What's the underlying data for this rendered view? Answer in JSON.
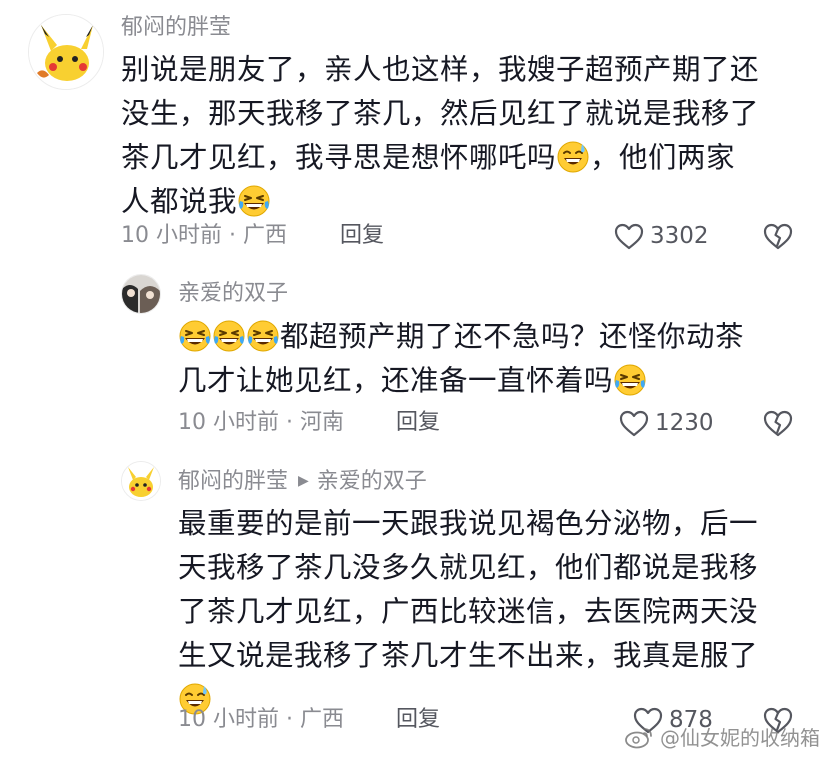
{
  "comments": [
    {
      "username": "郁闷的胖莹",
      "lines": [
        "别说是朋友了，亲人也这样，我嫂子超预产期了还",
        "没生，那天我移了茶几，然后见红了就说是我移了",
        "茶几才见红，我寻思是想怀哪吒吗",
        "人都说我"
      ],
      "line3_tail": "，他们两家",
      "meta": "10 小时前 · 广西",
      "reply": "回复",
      "likes": "3302"
    },
    {
      "username": "亲爱的双子",
      "line1": "都超预产期了还不急吗？还怪你动茶",
      "line2": "几才让她见红，还准备一直怀着吗",
      "meta": "10 小时前 · 河南",
      "reply": "回复",
      "likes": "1230"
    },
    {
      "username": "郁闷的胖莹",
      "reply_to": "亲爱的双子",
      "lines": [
        "最重要的是前一天跟我说见褐色分泌物，后一",
        "天我移了茶几没多久就见红，他们都说是我移",
        "了茶几才见红，广西比较迷信，去医院两天没",
        "生又说是我移了茶几才生不出来，我真是服了"
      ],
      "meta": "10 小时前 · 广西",
      "reply": "回复",
      "likes": "878"
    }
  ],
  "icons": {
    "like": "heart-outline-icon",
    "dislike": "broken-heart-icon",
    "sweat_smile": "sweat-smile-emoji",
    "laugh_cry": "rolling-laughing-emoji",
    "reply_arrow": "triangle-right-icon"
  },
  "watermark": "@仙女妮的收纳箱"
}
